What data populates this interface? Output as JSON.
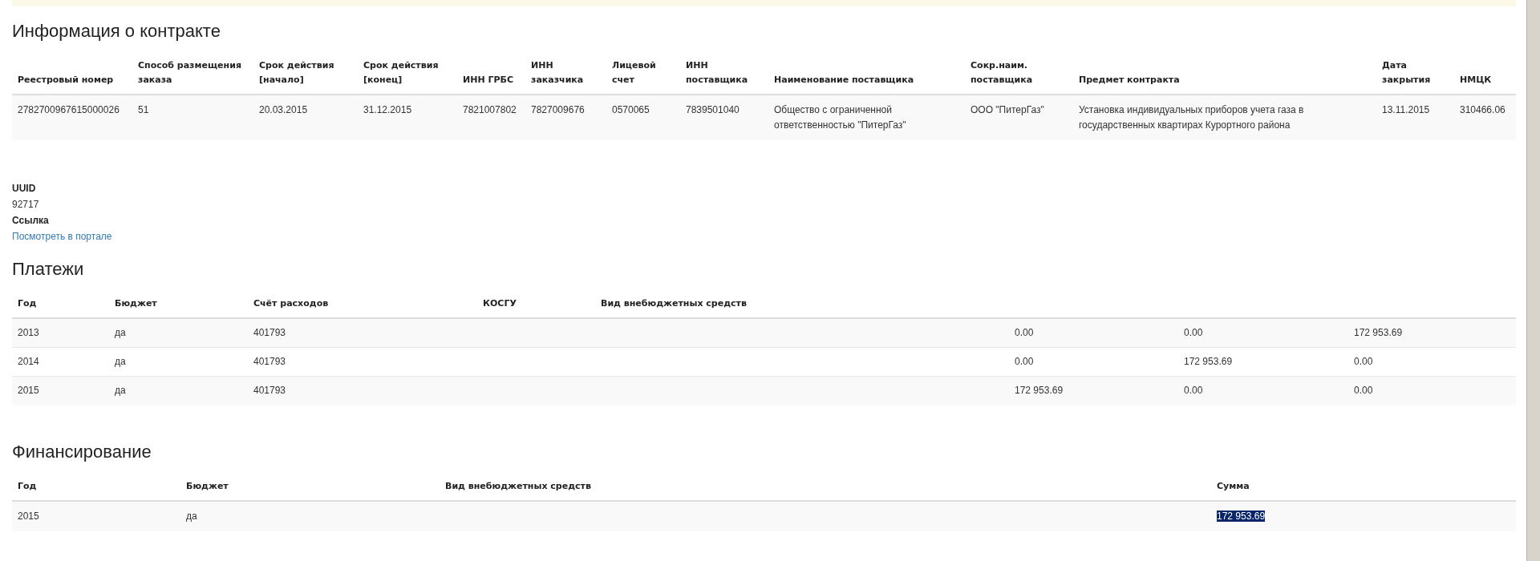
{
  "contract": {
    "title": "Информация о контракте",
    "columns": [
      "Реестровый номер",
      "Способ размещения заказа",
      "Срок действия [начало]",
      "Срок действия [конец]",
      "ИНН ГРБС",
      "ИНН заказчика",
      "Лицевой счет",
      "ИНН поставщика",
      "Наименование поставщика",
      "Сокр.наим. поставщика",
      "Предмет контракта",
      "Дата закрытия",
      "НМЦК"
    ],
    "rows": [
      [
        "2782700967615000026",
        "51",
        "20.03.2015",
        "31.12.2015",
        "7821007802",
        "7827009676",
        "0570065",
        "7839501040",
        "Общество с ограниченной ответственностью \"ПитерГаз\"",
        "ООО \"ПитерГаз\"",
        "Установка индивидуальных приборов учета газа в государственных квартирах Курортного района",
        "13.11.2015",
        "310466.06"
      ]
    ]
  },
  "details": [
    {
      "label": "UUID",
      "value": "92717",
      "kind": "text"
    },
    {
      "label": "Ссылка",
      "value": "Посмотреть в портале",
      "kind": "link"
    }
  ],
  "payments": {
    "title": "Платежи",
    "columns": [
      "Год",
      "Бюджет",
      "Счёт расходов",
      "КОСГУ",
      "Вид внебюджетных средств"
    ],
    "rows": [
      [
        "2013",
        "да",
        "401793",
        "",
        "",
        "0.00",
        "0.00",
        "172 953.69"
      ],
      [
        "2014",
        "да",
        "401793",
        "",
        "",
        "0.00",
        "172 953.69",
        "0.00"
      ],
      [
        "2015",
        "да",
        "401793",
        "",
        "",
        "172 953.69",
        "0.00",
        "0.00"
      ]
    ]
  },
  "financing": {
    "title": "Финансирование",
    "columns": [
      "Год",
      "Бюджет",
      "Вид внебюджетных средств",
      "Сумма"
    ],
    "rows": [
      {
        "cells": [
          "2015",
          "да",
          "",
          "172 953.69"
        ],
        "sum_highlighted": true
      }
    ]
  }
}
